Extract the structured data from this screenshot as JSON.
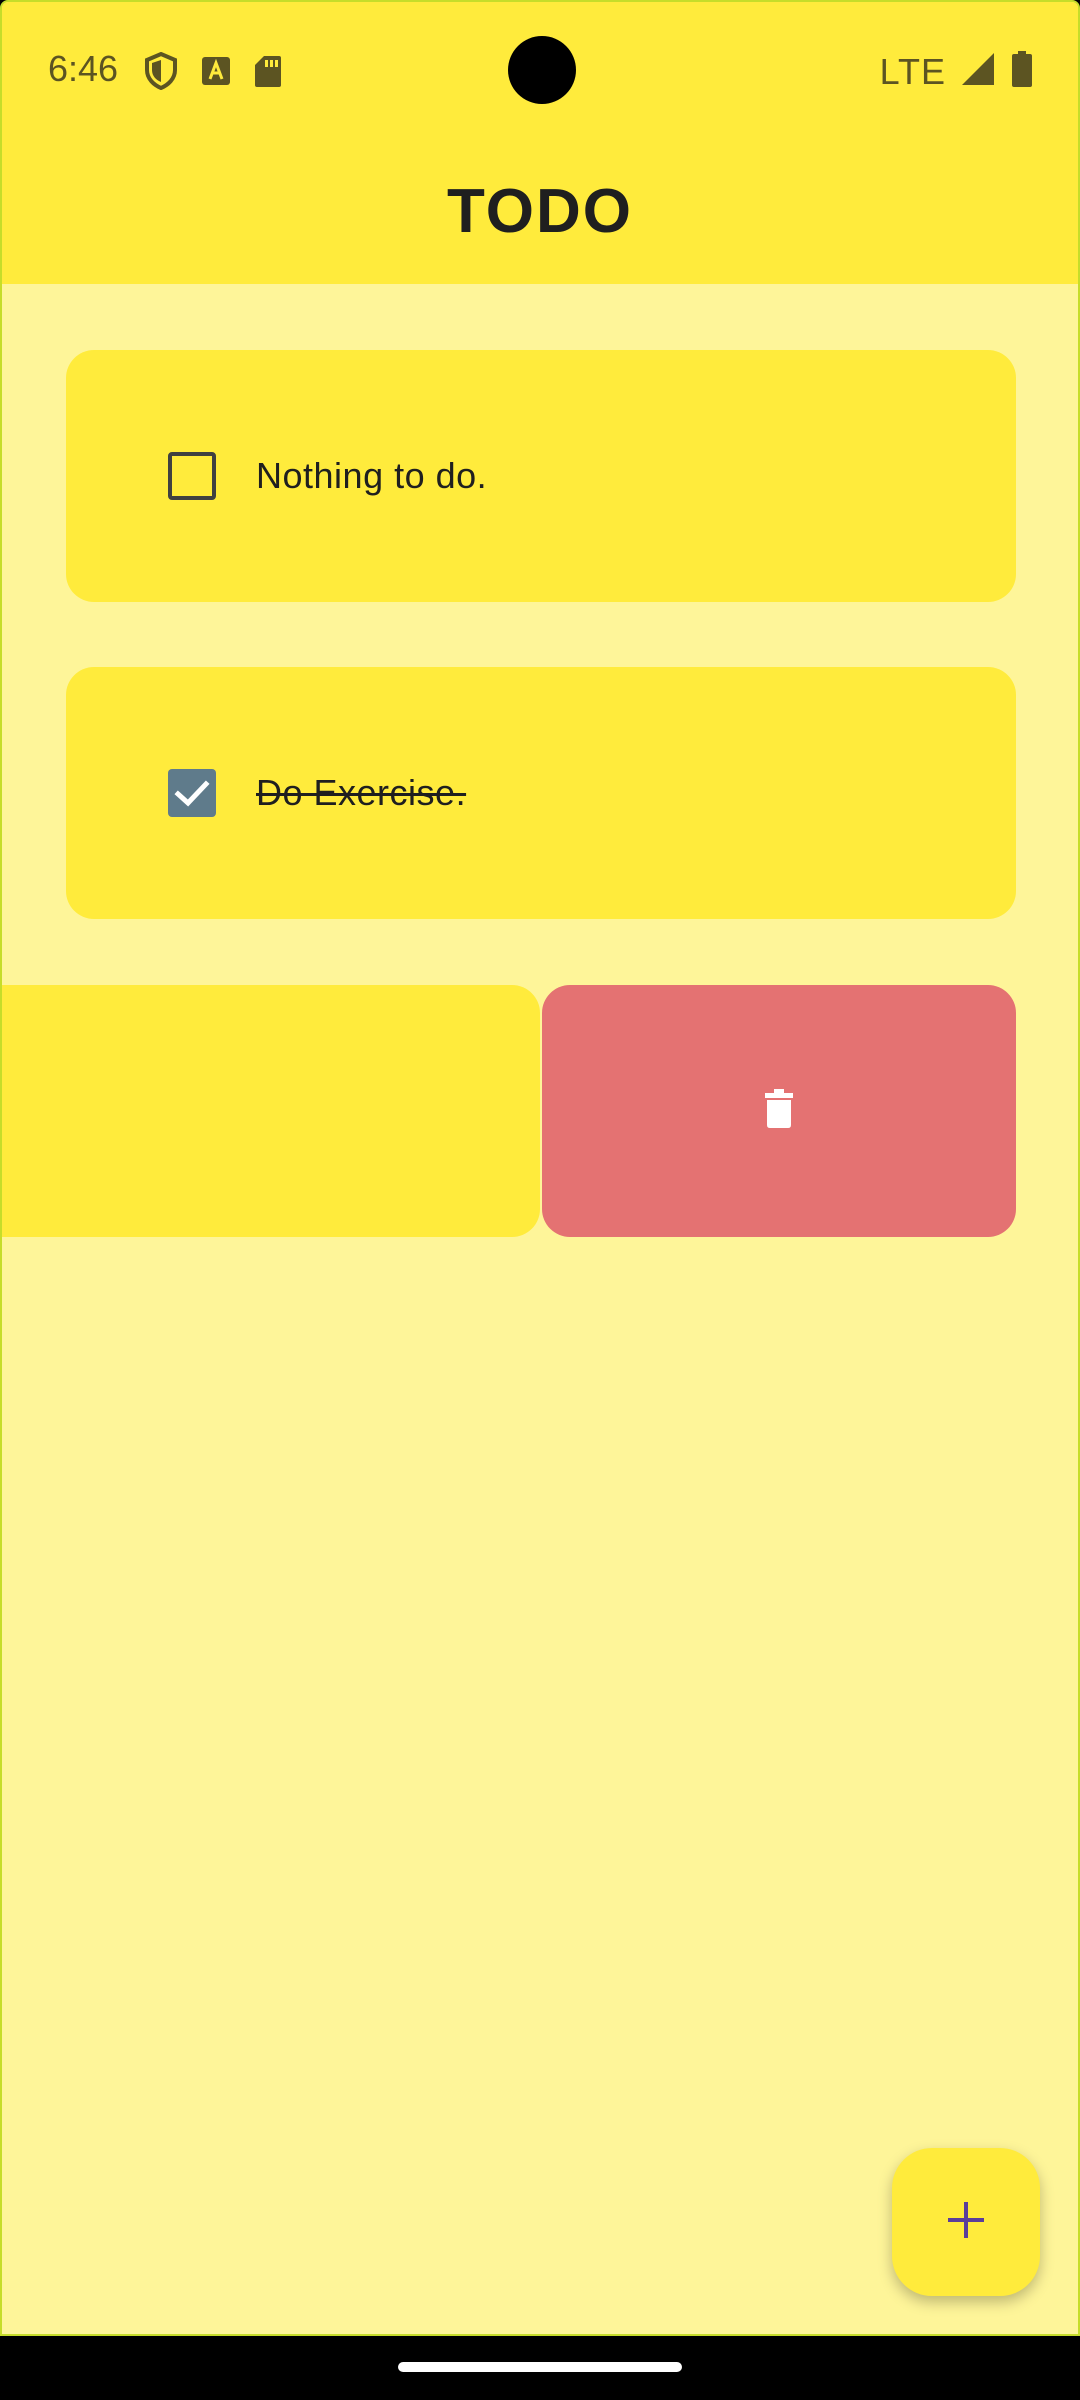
{
  "status_bar": {
    "time": "6:46",
    "left_icons": [
      "shield-icon",
      "font-a-icon",
      "sd-card-icon"
    ],
    "network": "LTE",
    "right_icons": [
      "signal-icon",
      "battery-icon"
    ]
  },
  "app_bar": {
    "title": "TODO"
  },
  "todos": [
    {
      "label": "Nothing to do.",
      "checked": false
    },
    {
      "label": "Do Exercise.",
      "checked": true
    }
  ],
  "swipe_action": {
    "icon": "trash-icon",
    "color": "#e47272"
  },
  "fab": {
    "icon": "plus-icon"
  },
  "colors": {
    "app_bar": "#ffeb3c",
    "background": "#fef599",
    "card": "#ffeb3c",
    "checkbox_checked": "#5f7b8b",
    "delete": "#e47272",
    "fab_icon": "#5b3e9a"
  }
}
